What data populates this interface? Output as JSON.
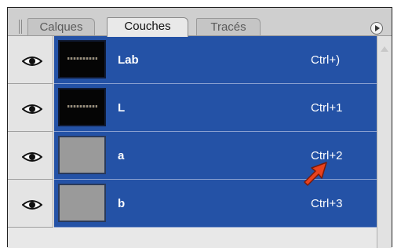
{
  "panel": {
    "tabs": [
      {
        "label": "Calques",
        "active": false
      },
      {
        "label": "Couches",
        "active": true
      },
      {
        "label": "Tracés",
        "active": false
      }
    ],
    "menu_icon": "panel-menu-icon"
  },
  "channels": [
    {
      "name": "Lab",
      "shortcut": "Ctrl+)",
      "visible": true,
      "thumbnail": "dark"
    },
    {
      "name": "L",
      "shortcut": "Ctrl+1",
      "visible": true,
      "thumbnail": "dark"
    },
    {
      "name": "a",
      "shortcut": "Ctrl+2",
      "visible": true,
      "thumbnail": "gray"
    },
    {
      "name": "b",
      "shortcut": "Ctrl+3",
      "visible": true,
      "thumbnail": "gray"
    }
  ],
  "colors": {
    "selection": "#2452a6",
    "pointer": "#e8421e",
    "panel_bg": "#d7d7d7"
  }
}
